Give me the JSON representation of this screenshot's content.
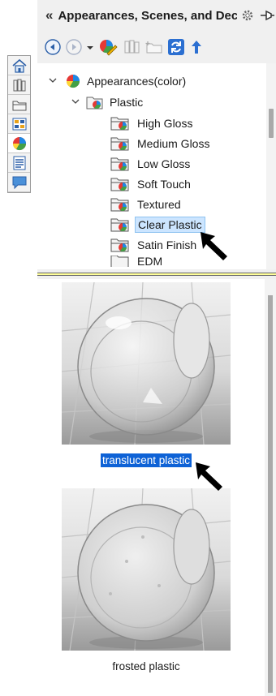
{
  "header": {
    "collapse_glyph": "«",
    "title": "Appearances, Scenes, and Decals"
  },
  "toolbar": {
    "buttons": [
      {
        "name": "back-icon"
      },
      {
        "name": "forward-icon"
      },
      {
        "name": "edit-appearance-icon"
      },
      {
        "name": "add-file-icon"
      },
      {
        "name": "add-folder-icon"
      },
      {
        "name": "refresh-icon"
      },
      {
        "name": "up-folder-icon"
      }
    ]
  },
  "side_tabs": [
    {
      "name": "home-icon"
    },
    {
      "name": "design-library-icon"
    },
    {
      "name": "file-explorer-icon"
    },
    {
      "name": "view-palette-icon"
    },
    {
      "name": "appearances-icon"
    },
    {
      "name": "custom-properties-icon"
    },
    {
      "name": "forum-icon"
    }
  ],
  "tree": {
    "root": "Appearances(color)",
    "group": "Plastic",
    "items": [
      "High Gloss",
      "Medium Gloss",
      "Low Gloss",
      "Soft Touch",
      "Textured",
      "Clear Plastic",
      "Satin Finish",
      "EDM"
    ],
    "selected": "Clear Plastic"
  },
  "swatches": [
    {
      "label": "translucent plastic",
      "selected": true
    },
    {
      "label": "frosted plastic",
      "selected": false
    }
  ],
  "colors": {
    "selection_fill": "#0e62d6",
    "tree_selection": "#cce5ff",
    "splitter": "#ffff99"
  }
}
